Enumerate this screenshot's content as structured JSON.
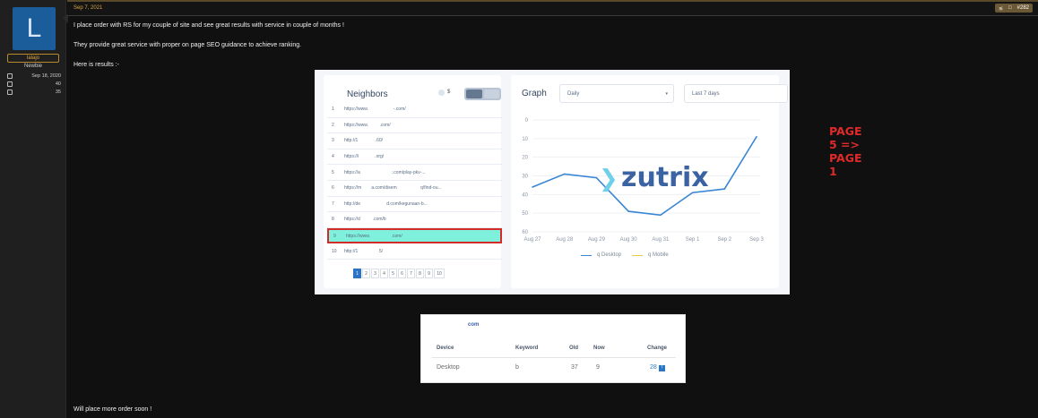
{
  "user": {
    "avatar_letter": "L",
    "name": "lalajo",
    "title": "Newbie",
    "joined": "Sep 18, 2020",
    "messages": "40",
    "reactions": "35"
  },
  "post": {
    "date": "Sep 7, 2021",
    "number": "#282",
    "line1": "I place order with RS for my couple of site and see great results with service in couple of months !",
    "line2": "They provide great service with proper on page SEO guidance to achieve ranking.",
    "line3": "Here is results :-",
    "closing": "Will place more order soon !"
  },
  "neighbors": {
    "title": "Neighbors",
    "dollar": "$",
    "rows": [
      {
        "n": "1",
        "url": "https://www.                    -.com/"
      },
      {
        "n": "2",
        "url": "https://www.         .com/"
      },
      {
        "n": "3",
        "url": "http://1              .60/"
      },
      {
        "n": "4",
        "url": "https://i             .org/"
      },
      {
        "n": "5",
        "url": "https://a                         :.com/play-pkv-..."
      },
      {
        "n": "6",
        "url": "https://m        a.com/disem                   q/find-ou..."
      },
      {
        "n": "7",
        "url": "http://de                     d.com/kegunaan-b..."
      },
      {
        "n": "8",
        "url": "https://d          .com/b"
      },
      {
        "n": "9",
        "url": "https://www.                 .com/"
      },
      {
        "n": "10",
        "url": "http://1                 5/"
      }
    ],
    "pages": [
      "1",
      "2",
      "3",
      "4",
      "5",
      "6",
      "7",
      "8",
      "9",
      "10"
    ]
  },
  "graph": {
    "title": "Graph",
    "period_select": "Daily",
    "range_select": "Last 7 days",
    "annotation": "PAGE 5 => PAGE 1",
    "logo_text": "zutrix",
    "legend_desktop": "q Desktop",
    "legend_mobile": "q Mobile"
  },
  "chart_data": {
    "type": "line",
    "x": [
      "Aug 27",
      "Aug 28",
      "Aug 29",
      "Aug 30",
      "Aug 31",
      "Sep 1",
      "Sep 2",
      "Sep 3"
    ],
    "yticks": [
      "0",
      "10",
      "20",
      "30",
      "40",
      "50",
      "60"
    ],
    "ylim": [
      0,
      60
    ],
    "y_inverted": true,
    "series": [
      {
        "name": "q Desktop",
        "color": "#3a86d4",
        "values": [
          36,
          29,
          31,
          49,
          51,
          39,
          37,
          9
        ]
      }
    ]
  },
  "ranking_table": {
    "domain": "com",
    "headers": {
      "device": "Device",
      "keyword": "Keyword",
      "old": "Old",
      "now": "Now",
      "change": "Change"
    },
    "row": {
      "device": "Desktop",
      "keyword": "b",
      "old": "37",
      "now": "9",
      "change": "28",
      "change_badge": "!"
    }
  },
  "colors": {
    "accent": "#d9a743",
    "highlight_row": "#7ff0dc",
    "annotation": "#e02a2a",
    "line": "#3a86d4"
  }
}
